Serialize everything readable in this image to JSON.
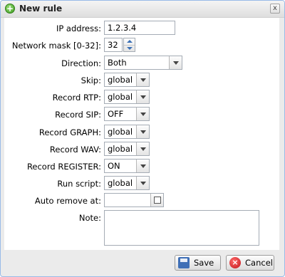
{
  "window": {
    "title": "New rule",
    "close_glyph": "x"
  },
  "form": {
    "ip_label": "IP address:",
    "ip_value": "1.2.3.4",
    "mask_label": "Network mask [0-32]:",
    "mask_value": "32",
    "direction_label": "Direction:",
    "direction_value": "Both",
    "skip_label": "Skip:",
    "skip_value": "global",
    "rtp_label": "Record RTP:",
    "rtp_value": "global",
    "sip_label": "Record SIP:",
    "sip_value": "OFF",
    "graph_label": "Record GRAPH:",
    "graph_value": "global",
    "wav_label": "Record WAV:",
    "wav_value": "global",
    "register_label": "Record REGISTER:",
    "register_value": "ON",
    "script_label": "Run script:",
    "script_value": "global",
    "autoremove_label": "Auto remove at:",
    "autoremove_value": "",
    "note_label": "Note:",
    "note_value": ""
  },
  "buttons": {
    "save": "Save",
    "cancel": "Cancel"
  },
  "icons": {
    "title": "add-circle-icon",
    "save": "save-disk-icon",
    "cancel": "cancel-icon"
  }
}
